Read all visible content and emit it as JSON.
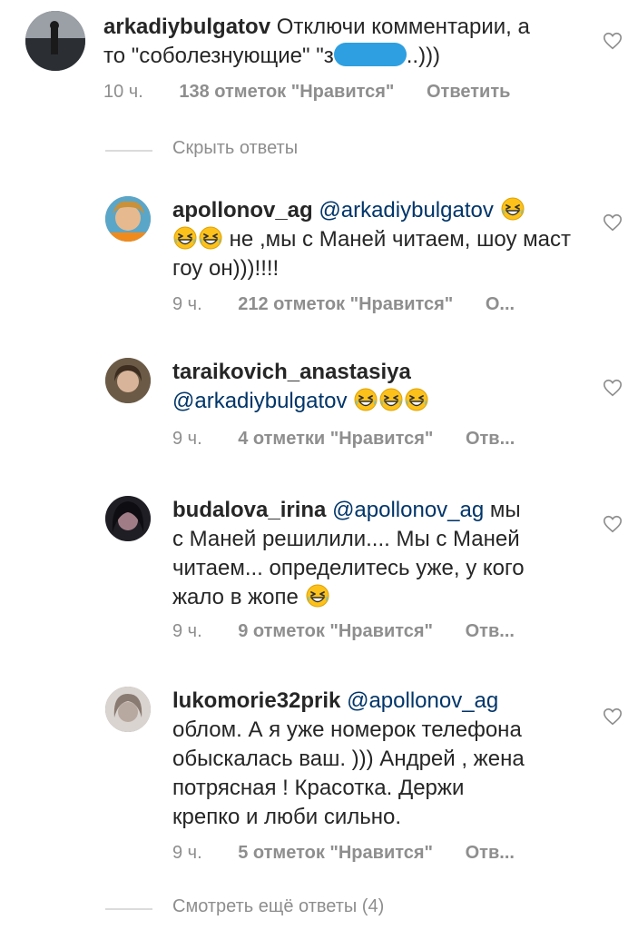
{
  "comments": [
    {
      "username": "arkadiybulgatov",
      "text_part1": "Отключи комментарии, а",
      "text_part2": "то \"соболезнующие\" \"з",
      "text_part3": "..)))",
      "time": "10 ч.",
      "likes": "138 отметок \"Нравится\"",
      "reply": "Ответить"
    },
    {
      "username": "apollonov_ag",
      "mention": "@arkadiybulgatov",
      "text": "не ,мы с Маней читаем, шоу маст гоу он)))!!!!",
      "time": "9 ч.",
      "likes": "212 отметок \"Нравится\"",
      "reply": "О..."
    },
    {
      "username": "taraikovich_anastasiya",
      "mention": "@arkadiybulgatov",
      "time": "9 ч.",
      "likes": "4 отметки \"Нравится\"",
      "reply": "Отв..."
    },
    {
      "username": "budalova_irina",
      "mention": "@apollonov_ag",
      "text_line1": "мы",
      "text_line2": "с Маней решилили.... Мы с Маней",
      "text_line3": "читаем... определитесь уже, у кого",
      "text_line4": "жало в жопе",
      "time": "9 ч.",
      "likes": "9 отметок \"Нравится\"",
      "reply": "Отв..."
    },
    {
      "username": "lukomorie32prik",
      "mention": "@apollonov_ag",
      "text_line1": "облом. А я уже  номерок телефона",
      "text_line2": "обыскалась ваш. ))) Андрей , жена",
      "text_line3": "потрясная ! Красотка. Держи",
      "text_line4": "крепко и люби сильно.",
      "time": "9 ч.",
      "likes": "5 отметок \"Нравится\"",
      "reply": "Отв..."
    }
  ],
  "hide_replies": "Скрыть ответы",
  "more_replies": "Смотреть ещё ответы (4)",
  "colors": {
    "text": "#262626",
    "secondary": "#8e8e8e",
    "mention": "#003569"
  },
  "icons": [
    "heart-outline-icon",
    "grinning-squinting-face-emoji"
  ]
}
